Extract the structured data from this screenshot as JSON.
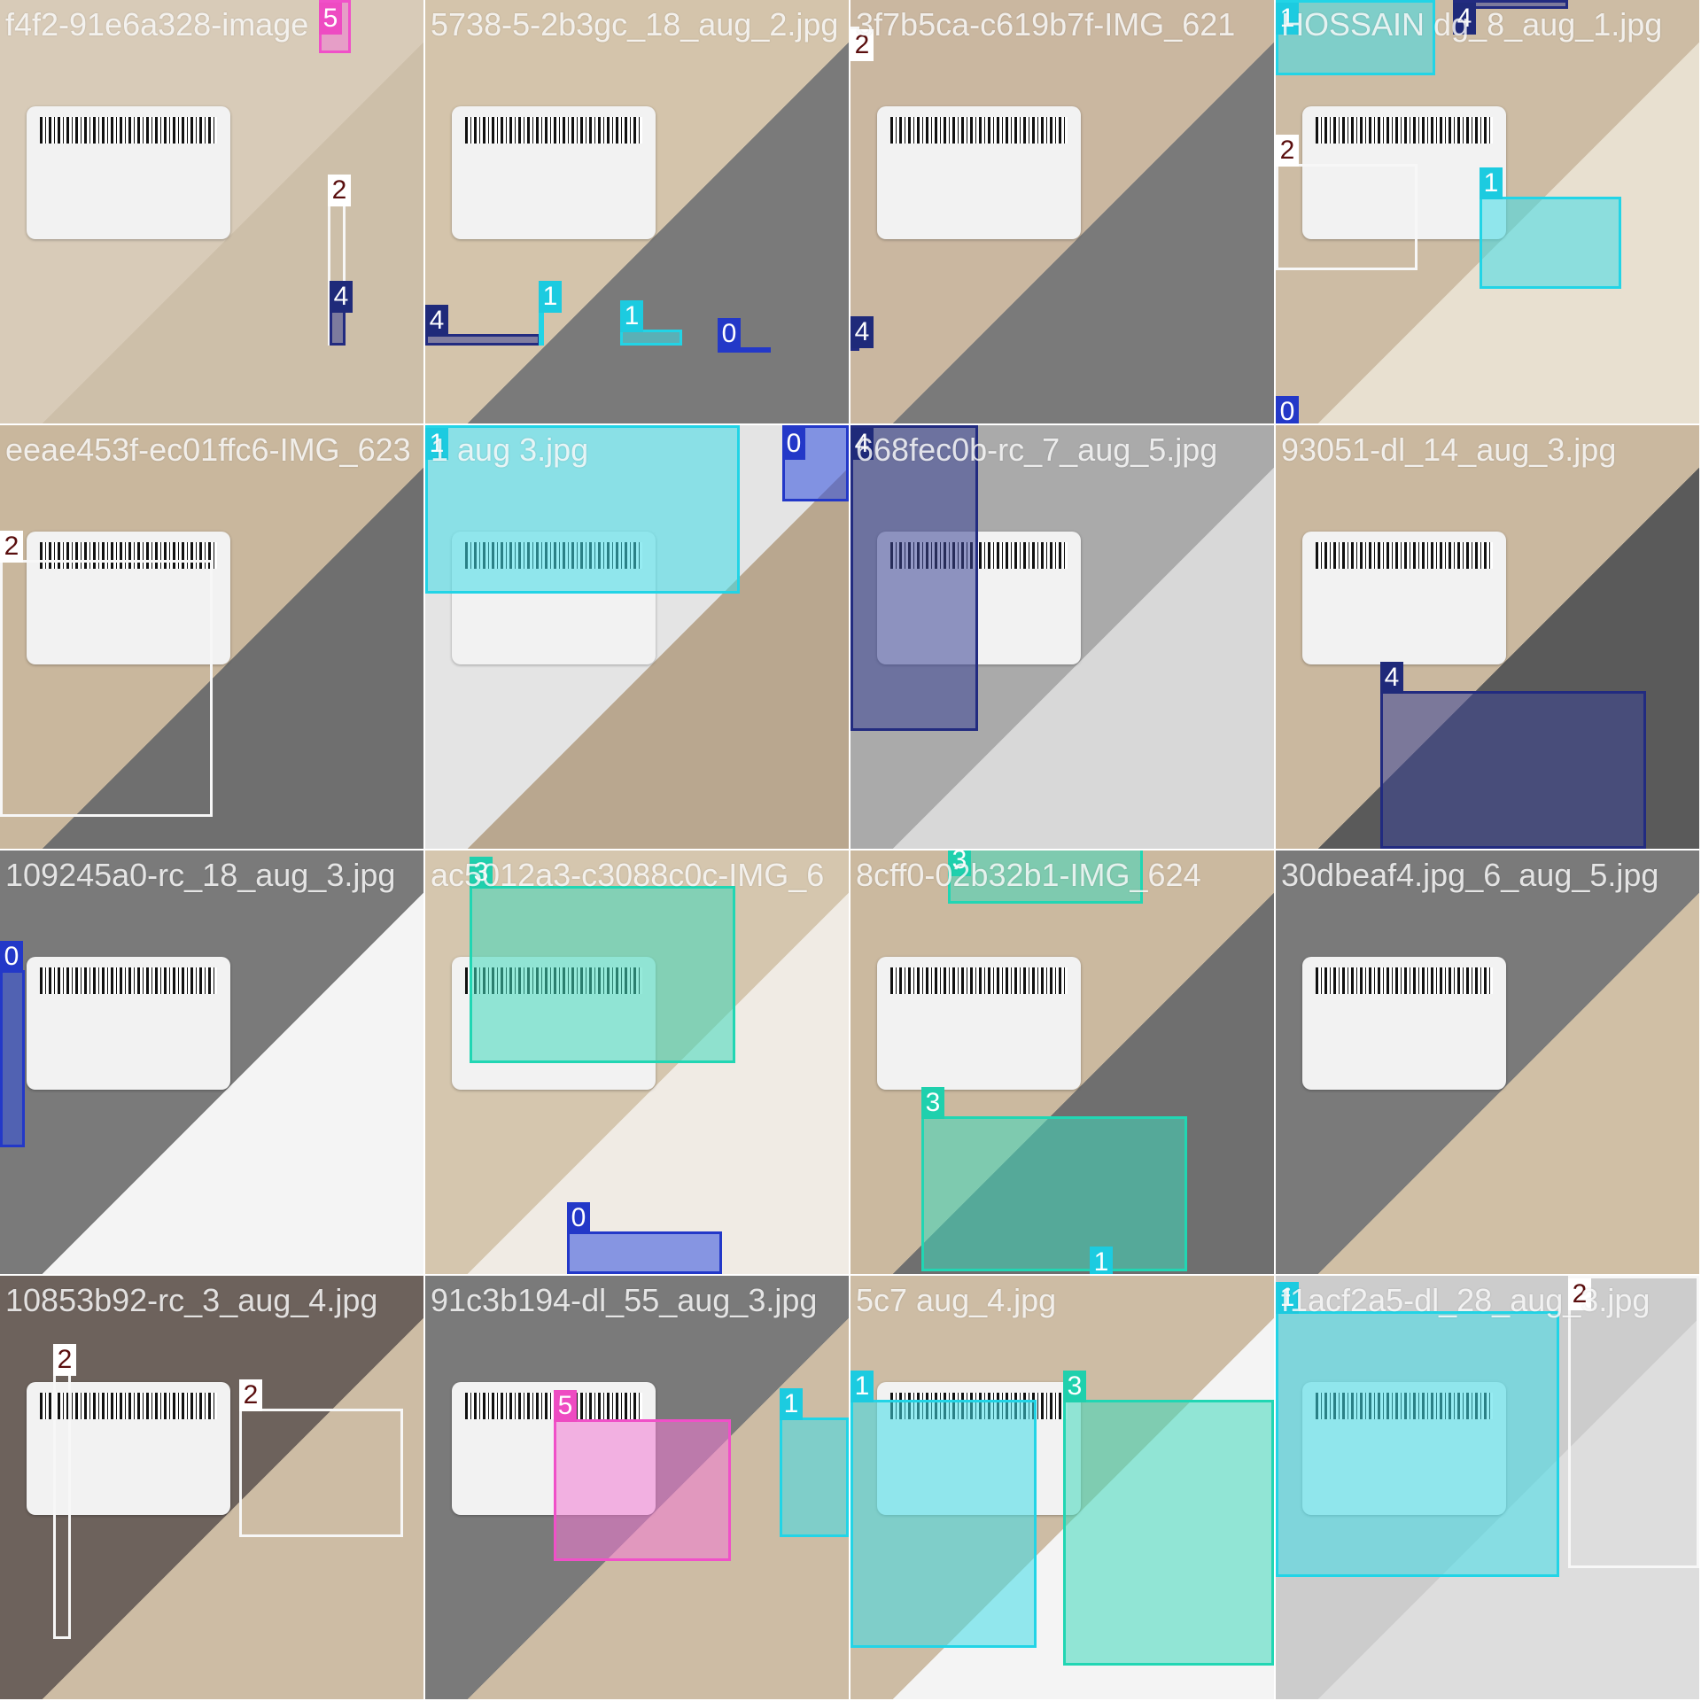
{
  "mosaic": {
    "tiles": [
      {
        "filename": "f4f2-91e6a328-image",
        "bg": [
          "#d8cbb8",
          "#cdbfa9"
        ],
        "boxes": [
          {
            "cls": "5"
          },
          {
            "cls": "2"
          },
          {
            "cls": "4"
          }
        ]
      },
      {
        "filename": "5738-5-2b3gc_18_aug_2.jpg",
        "bg": [
          "#d4c4ab",
          "#7a7a7a"
        ],
        "boxes": [
          {
            "cls": "4"
          },
          {
            "cls": "1"
          },
          {
            "cls": "1"
          },
          {
            "cls": "0"
          }
        ]
      },
      {
        "filename": "3f7b5ca-c619b7f-IMG_621",
        "bg": [
          "#cab7a0",
          "#7a7a7a"
        ],
        "boxes": [
          {
            "cls": "2"
          },
          {
            "cls": "4"
          }
        ]
      },
      {
        "filename": "HOSSAIN dg_8_aug_1.jpg",
        "bg": [
          "#cdbca4",
          "#e8e0d0"
        ],
        "boxes": [
          {
            "cls": "1"
          },
          {
            "cls": "4"
          },
          {
            "cls": "2"
          },
          {
            "cls": "1"
          },
          {
            "cls": "0"
          }
        ]
      },
      {
        "filename": "eeae453f-ec01ffc6-IMG_623",
        "bg": [
          "#c9b79d",
          "#6f6f6f"
        ],
        "boxes": [
          {
            "cls": "2"
          }
        ]
      },
      {
        "filename": "1 aug 3.jpg",
        "bg": [
          "#e4e4e4",
          "#b9a78f"
        ],
        "boxes": [
          {
            "cls": "1"
          },
          {
            "cls": "0"
          }
        ]
      },
      {
        "filename": "668fec0b-rc_7_aug_5.jpg",
        "bg": [
          "#aaaaaa",
          "#d8d8d8"
        ],
        "boxes": [
          {
            "cls": "4"
          }
        ]
      },
      {
        "filename": "93051-dl_14_aug_3.jpg",
        "bg": [
          "#cab89f",
          "#5a5a5a"
        ],
        "boxes": [
          {
            "cls": "4"
          }
        ]
      },
      {
        "filename": "109245a0-rc_18_aug_3.jpg",
        "bg": [
          "#7a7a7a",
          "#f4f4f4"
        ],
        "boxes": [
          {
            "cls": "0"
          }
        ]
      },
      {
        "filename": "ac5012a3-c3088c0c-IMG_6",
        "bg": [
          "#d5c6ae",
          "#f0ebe4"
        ],
        "boxes": [
          {
            "cls": "3"
          },
          {
            "cls": "0"
          }
        ]
      },
      {
        "filename": "8cff0-02b32b1-IMG_624",
        "bg": [
          "#cbb99f",
          "#6f6f6f"
        ],
        "boxes": [
          {
            "cls": "3"
          },
          {
            "cls": "3"
          },
          {
            "cls": "1"
          }
        ]
      },
      {
        "filename": "30dbeaf4.jpg_6_aug_5.jpg",
        "bg": [
          "#7a7a7a",
          "#d0bfa5"
        ],
        "boxes": []
      },
      {
        "filename": "10853b92-rc_3_aug_4.jpg",
        "bg": [
          "#6d625c",
          "#cdbca4"
        ],
        "boxes": [
          {
            "cls": "2"
          },
          {
            "cls": "2"
          }
        ]
      },
      {
        "filename": "91c3b194-dl_55_aug_3.jpg",
        "bg": [
          "#7a7a7a",
          "#cdbca4"
        ],
        "boxes": [
          {
            "cls": "5"
          },
          {
            "cls": "1"
          }
        ]
      },
      {
        "filename": "5c7 aug_4.jpg",
        "bg": [
          "#cdbca4",
          "#f4f4f4"
        ],
        "boxes": [
          {
            "cls": "1"
          },
          {
            "cls": "3"
          }
        ]
      },
      {
        "filename": "f1acf2a5-dl_28_aug_3.jpg",
        "bg": [
          "#cccccc",
          "#dddddd"
        ],
        "boxes": [
          {
            "cls": "1"
          },
          {
            "cls": "2"
          }
        ]
      }
    ]
  }
}
